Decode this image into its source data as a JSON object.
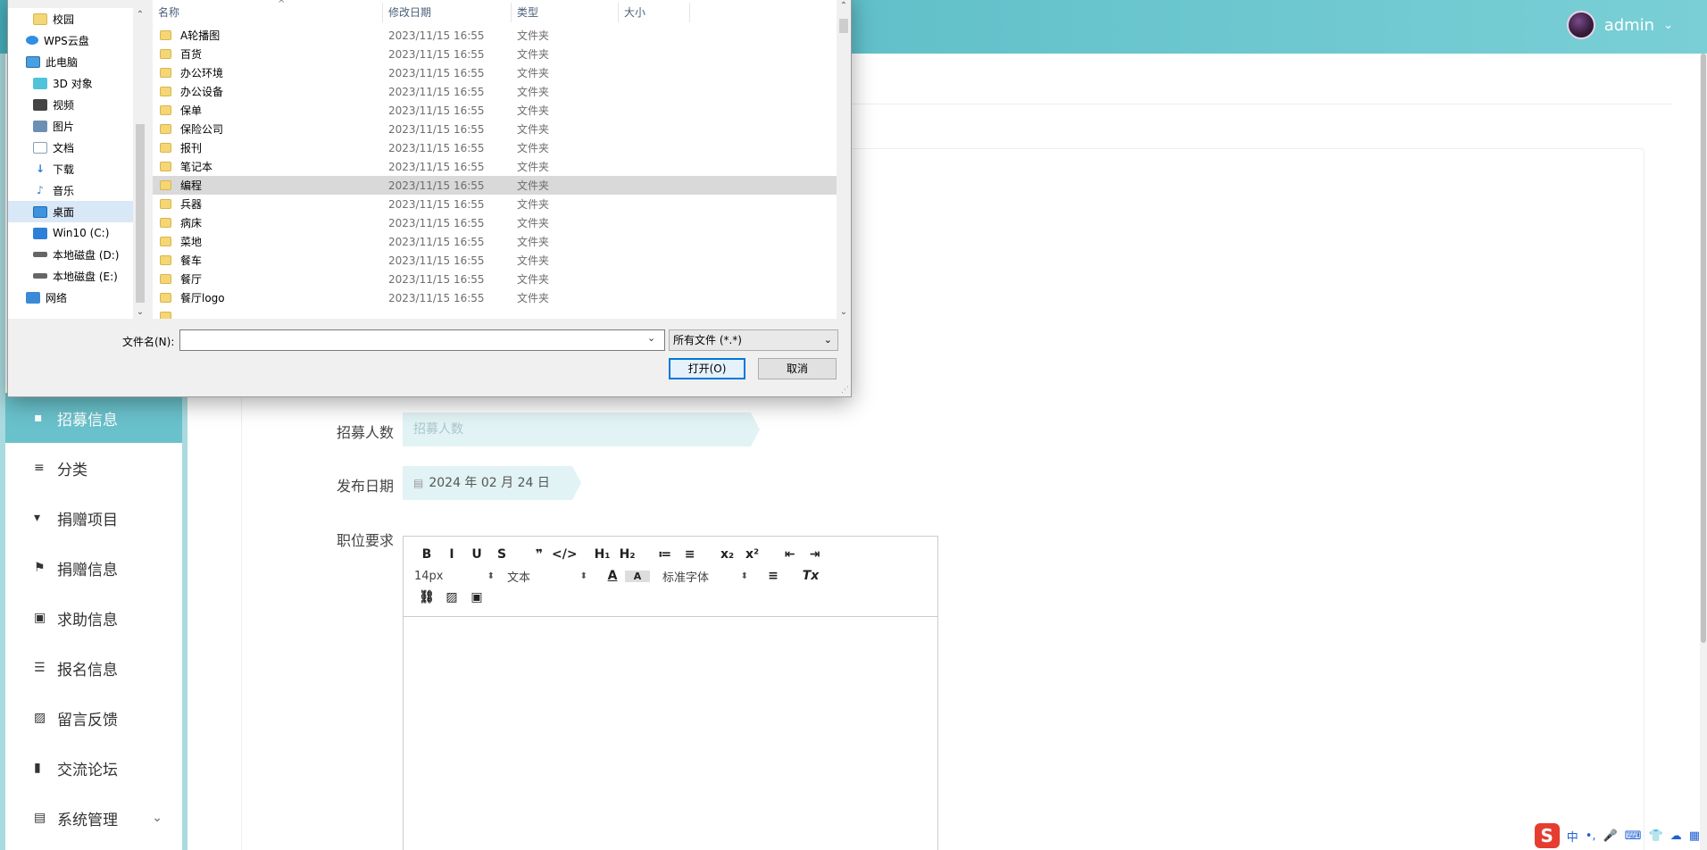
{
  "header": {
    "user_name": "admin",
    "chevron": "⌄"
  },
  "sidebar": {
    "items": [
      {
        "label": "招募信息",
        "icon": "▪",
        "active": true
      },
      {
        "label": "分类",
        "icon": "≡"
      },
      {
        "label": "捐赠项目",
        "icon": "▾"
      },
      {
        "label": "捐赠信息",
        "icon": "⚑"
      },
      {
        "label": "求助信息",
        "icon": "▣"
      },
      {
        "label": "报名信息",
        "icon": "☰"
      },
      {
        "label": "留言反馈",
        "icon": "▨"
      },
      {
        "label": "交流论坛",
        "icon": "▮"
      },
      {
        "label": "系统管理",
        "icon": "▤",
        "arrow": "⌄"
      }
    ]
  },
  "form": {
    "recruit_count_label": "招募人数",
    "recruit_count_placeholder": "招募人数",
    "publish_date_label": "发布日期",
    "publish_date_value": "2024 年 02 月 24 日",
    "job_req_label": "职位要求"
  },
  "editor": {
    "row1": [
      "B",
      "I",
      "U",
      "S",
      "❞",
      "</>",
      "H₁",
      "H₂",
      "≔",
      "≡",
      "x₂",
      "x²",
      "⇤",
      "⇥"
    ],
    "size_select": "14px",
    "text_select": "文本",
    "font_select": "标准字体",
    "clear_format": "Tx"
  },
  "ime": {
    "logo": "S",
    "items": [
      "中",
      "•,",
      "🎤",
      "⌨",
      "👕",
      "☁",
      "▦"
    ]
  },
  "dialog": {
    "nav": [
      {
        "label": "校园",
        "icon": "ic-folder",
        "indent": 28
      },
      {
        "label": "WPS云盘",
        "icon": "ic-cloud",
        "indent": 20
      },
      {
        "label": "此电脑",
        "icon": "ic-pc",
        "indent": 20
      },
      {
        "label": "3D 对象",
        "icon": "ic-cube",
        "indent": 28
      },
      {
        "label": "视频",
        "icon": "ic-video",
        "indent": 28
      },
      {
        "label": "图片",
        "icon": "ic-pic",
        "indent": 28
      },
      {
        "label": "文档",
        "icon": "ic-doc",
        "indent": 28
      },
      {
        "label": "下载",
        "icon": "ic-down",
        "glyph": "↓",
        "indent": 28
      },
      {
        "label": "音乐",
        "icon": "ic-music",
        "glyph": "♪",
        "indent": 28
      },
      {
        "label": "桌面",
        "icon": "ic-desk",
        "indent": 28,
        "selected": true
      },
      {
        "label": "Win10 (C:)",
        "icon": "ic-win",
        "indent": 28
      },
      {
        "label": "本地磁盘 (D:)",
        "icon": "ic-drive",
        "indent": 28
      },
      {
        "label": "本地磁盘 (E:)",
        "icon": "ic-drive",
        "indent": 28
      },
      {
        "label": "网络",
        "icon": "ic-net",
        "indent": 20
      }
    ],
    "columns": {
      "name": "名称",
      "date": "修改日期",
      "type": "类型",
      "size": "大小"
    },
    "files": [
      {
        "name": "A轮播图",
        "date": "2023/11/15 16:55",
        "type": "文件夹"
      },
      {
        "name": "百货",
        "date": "2023/11/15 16:55",
        "type": "文件夹"
      },
      {
        "name": "办公环境",
        "date": "2023/11/15 16:55",
        "type": "文件夹"
      },
      {
        "name": "办公设备",
        "date": "2023/11/15 16:55",
        "type": "文件夹"
      },
      {
        "name": "保单",
        "date": "2023/11/15 16:55",
        "type": "文件夹"
      },
      {
        "name": "保险公司",
        "date": "2023/11/15 16:55",
        "type": "文件夹"
      },
      {
        "name": "报刊",
        "date": "2023/11/15 16:55",
        "type": "文件夹"
      },
      {
        "name": "笔记本",
        "date": "2023/11/15 16:55",
        "type": "文件夹"
      },
      {
        "name": "编程",
        "date": "2023/11/15 16:55",
        "type": "文件夹",
        "selected": true
      },
      {
        "name": "兵器",
        "date": "2023/11/15 16:55",
        "type": "文件夹"
      },
      {
        "name": "病床",
        "date": "2023/11/15 16:55",
        "type": "文件夹"
      },
      {
        "name": "菜地",
        "date": "2023/11/15 16:55",
        "type": "文件夹"
      },
      {
        "name": "餐车",
        "date": "2023/11/15 16:55",
        "type": "文件夹"
      },
      {
        "name": "餐厅",
        "date": "2023/11/15 16:55",
        "type": "文件夹"
      },
      {
        "name": "餐厅logo",
        "date": "2023/11/15 16:55",
        "type": "文件夹"
      },
      {
        "name": "…",
        "date": "",
        "type": "…"
      }
    ],
    "filename_label": "文件名(N):",
    "filename_value": "",
    "filetype_value": "所有文件 (*.*)",
    "open_label": "打开(O)",
    "cancel_label": "取消"
  },
  "colors": {
    "header": "#46b0bc",
    "accent": "#69c1cb",
    "pill": "#e1f3f4",
    "selection": "#d9e8f7"
  }
}
